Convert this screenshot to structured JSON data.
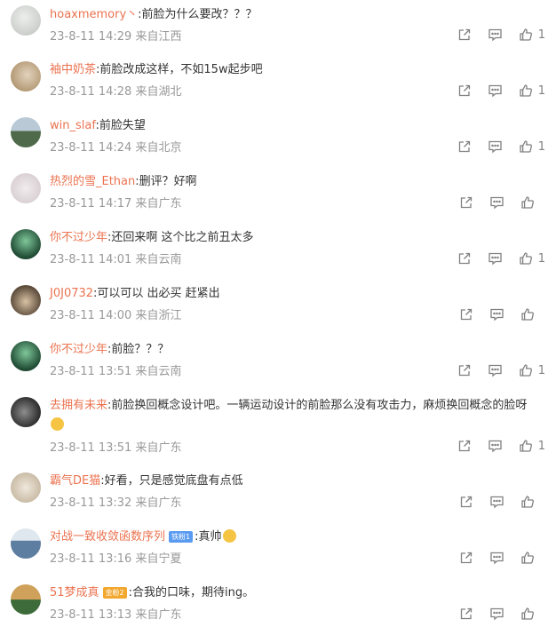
{
  "comments": [
    {
      "username": "hoaxmemory丶",
      "text": ":前脸为什么要改？？？",
      "timestamp": "23-8-11 14:29",
      "location": "来自江西",
      "likes": "1",
      "avatar_colors": [
        "#c9ccc9",
        "#ecefeb"
      ]
    },
    {
      "username": "袖中奶茶",
      "text": ":前脸改成这样，不如15w起步吧",
      "timestamp": "23-8-11 14:28",
      "location": "来自湖北",
      "likes": "1",
      "avatar_colors": [
        "#b49a76",
        "#e2d3bd"
      ]
    },
    {
      "username": "win_slaf",
      "text": ":前脸失望",
      "timestamp": "23-8-11 14:24",
      "location": "来自北京",
      "likes": "1",
      "avatar_colors": [
        "#4e6a4a",
        "#b9c9d6"
      ]
    },
    {
      "username": "热烈的雪_Ethan",
      "text": ":删评？好啊",
      "timestamp": "23-8-11 14:17",
      "location": "来自广东",
      "likes": "",
      "avatar_colors": [
        "#d8cfd2",
        "#f1ecee"
      ]
    },
    {
      "username": "你不过少年",
      "text": ":还回来啊  这个比之前丑太多",
      "timestamp": "23-8-11 14:01",
      "location": "来自云南",
      "likes": "1",
      "avatar_colors": [
        "#1f4a33",
        "#7fc79a"
      ]
    },
    {
      "username": "J0J0732",
      "text": ":可以可以 出必买 赶紧出",
      "timestamp": "23-8-11 14:00",
      "location": "来自浙江",
      "likes": "",
      "avatar_colors": [
        "#5b4a3a",
        "#d8c2a4"
      ]
    },
    {
      "username": "你不过少年",
      "text": ":前脸？？？",
      "timestamp": "23-8-11 13:51",
      "location": "来自云南",
      "likes": "1",
      "avatar_colors": [
        "#1f4a33",
        "#7fc79a"
      ]
    },
    {
      "username": "去拥有未来",
      "text": ":前脸换回概念设计吧。一辆运动设计的前脸那么没有攻击力，麻烦换回概念的脸呀",
      "timestamp": "23-8-11 13:51",
      "location": "来自广东",
      "likes": "1",
      "avatar_colors": [
        "#2e2e2e",
        "#8d8d8d"
      ]
    },
    {
      "username": "霸气DE猫",
      "text": ":好看，只是感觉底盘有点低",
      "timestamp": "23-8-11 13:32",
      "location": "来自广东",
      "likes": "",
      "avatar_colors": [
        "#c7b9a3",
        "#f0e8dc"
      ]
    },
    {
      "username": "对战一致收敛函数序列",
      "badge": "铁粉1",
      "text": ":真帅",
      "timestamp": "23-8-11 13:16",
      "location": "来自宁夏",
      "likes": "",
      "avatar_colors": [
        "#5d7ea0",
        "#dfe8ef"
      ]
    },
    {
      "username": "51梦成真",
      "badge": "金粉2",
      "text": ":合我的口味，期待ing。",
      "timestamp": "23-8-11 13:13",
      "location": "来自广东",
      "likes": "",
      "avatar_colors": [
        "#3d6b3a",
        "#d0a15a"
      ]
    }
  ],
  "colors": {
    "username": "#eb7350",
    "meta": "#999999",
    "icon": "#808080",
    "badge_blue": "#5a9bf0",
    "badge_gold": "#f2a72e"
  },
  "icons": {
    "share": "share-icon",
    "comment": "comment-icon",
    "like": "like-icon",
    "emoji": "laughing-emoji-icon"
  }
}
